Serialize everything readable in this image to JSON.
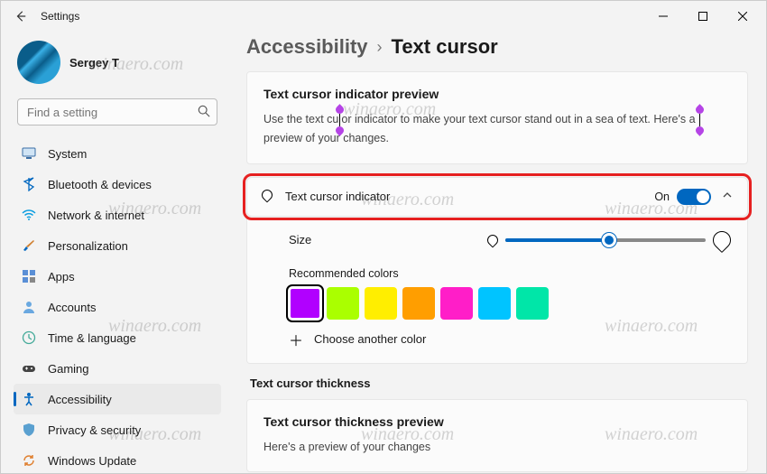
{
  "titlebar": {
    "title": "Settings"
  },
  "profile": {
    "name": "Sergey T"
  },
  "search": {
    "placeholder": "Find a setting"
  },
  "nav": [
    {
      "label": "System",
      "icon": "system"
    },
    {
      "label": "Bluetooth & devices",
      "icon": "bluetooth"
    },
    {
      "label": "Network & internet",
      "icon": "wifi"
    },
    {
      "label": "Personalization",
      "icon": "brush"
    },
    {
      "label": "Apps",
      "icon": "apps"
    },
    {
      "label": "Accounts",
      "icon": "person"
    },
    {
      "label": "Time & language",
      "icon": "clock"
    },
    {
      "label": "Gaming",
      "icon": "game"
    },
    {
      "label": "Accessibility",
      "icon": "access",
      "active": true
    },
    {
      "label": "Privacy & security",
      "icon": "shield"
    },
    {
      "label": "Windows Update",
      "icon": "update"
    }
  ],
  "breadcrumb": {
    "parent": "Accessibility",
    "sep": "›",
    "current": "Text cursor"
  },
  "preview": {
    "heading": "Text cursor indicator preview",
    "text_before": "Use the text cu",
    "text_mid": "or indicator to make your text cursor stand out in a sea of text. Here's a",
    "text_after": "preview of your changes."
  },
  "indicator": {
    "label": "Text cursor indicator",
    "state": "On"
  },
  "size": {
    "label": "Size"
  },
  "colors": {
    "label": "Recommended colors",
    "swatches": [
      "#b100ff",
      "#aaff00",
      "#ffee00",
      "#ff9e00",
      "#ff1ec8",
      "#00c4ff",
      "#00e6a8"
    ],
    "selected": 0,
    "another": "Choose another color"
  },
  "thickness": {
    "section": "Text cursor thickness",
    "heading": "Text cursor thickness preview",
    "text": "Here's a preview of your changes"
  },
  "watermark": "winaero.com"
}
